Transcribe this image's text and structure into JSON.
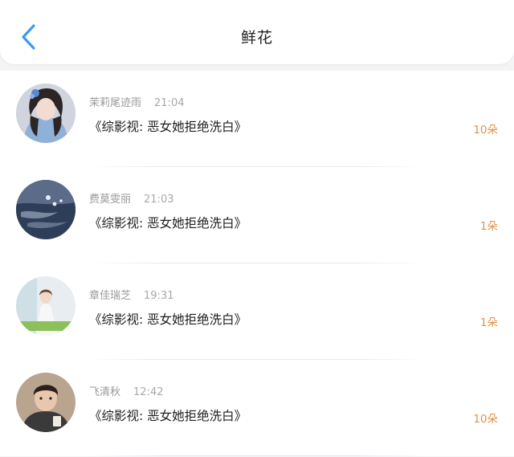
{
  "header": {
    "title": "鲜花",
    "back_icon": "chevron-left-icon",
    "accent_color": "#3a9cf0"
  },
  "records": [
    {
      "name": "茉莉尾迹雨",
      "time": "21:04",
      "work": "《综影视: 恶女她拒绝洗白》",
      "count": "10朵",
      "avatar": "avatar-girl-portrait"
    },
    {
      "name": "费莫雯丽",
      "time": "21:03",
      "work": "《综影视: 恶女她拒绝洗白》",
      "count": "1朵",
      "avatar": "avatar-lake-scene"
    },
    {
      "name": "章佳瑞芝",
      "time": "19:31",
      "work": "《综影视: 恶女她拒绝洗白》",
      "count": "1朵",
      "avatar": "avatar-white-dress"
    },
    {
      "name": "飞清秋",
      "time": "12:42",
      "work": "《综影视: 恶女她拒绝洗白》",
      "count": "10朵",
      "avatar": "avatar-boy-portrait"
    }
  ],
  "colors": {
    "count": "#e0914a",
    "name": "#9a9a9a",
    "background": "#f4f4f6"
  }
}
